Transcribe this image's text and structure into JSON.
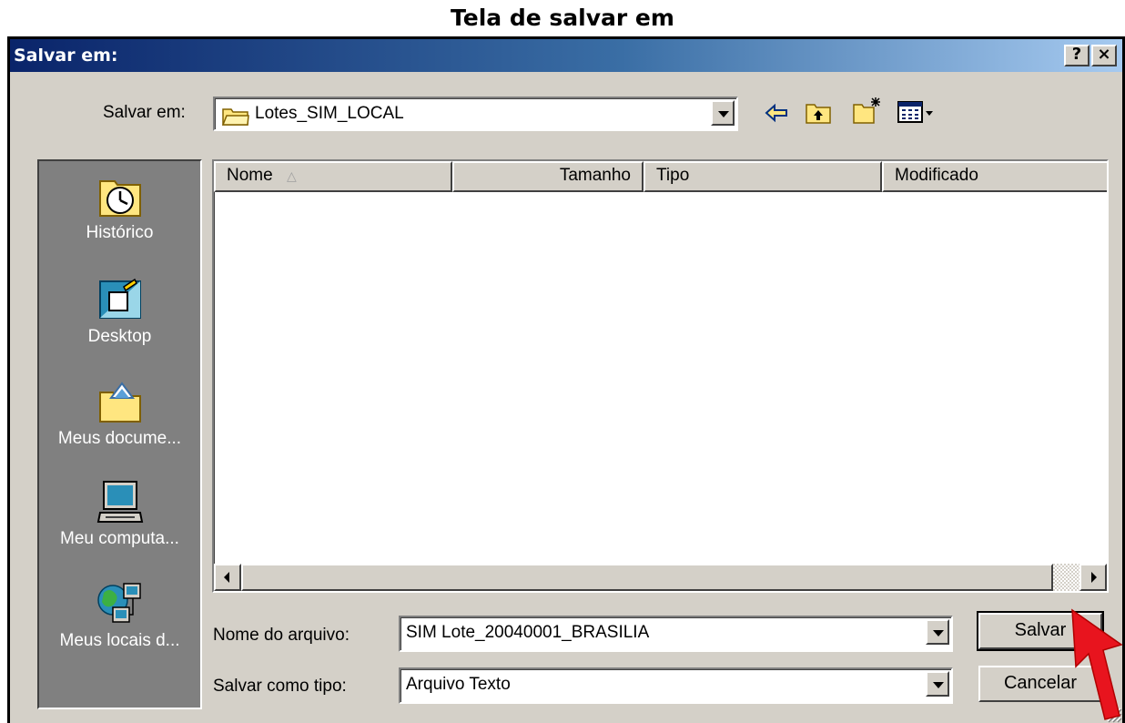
{
  "caption": "Tela de salvar em",
  "dialog": {
    "title": "Salvar em:",
    "help_label": "?",
    "close_label": "×"
  },
  "save_in": {
    "label": "Salvar em:",
    "value": "Lotes_SIM_LOCAL",
    "icons": [
      "folder-icon",
      "back-arrow-icon",
      "up-folder-icon",
      "new-folder-icon",
      "view-menu-icon"
    ]
  },
  "places": [
    {
      "label": "Histórico",
      "icon": "history-icon"
    },
    {
      "label": "Desktop",
      "icon": "desktop-icon"
    },
    {
      "label": "Meus docume...",
      "icon": "my-documents-icon"
    },
    {
      "label": "Meu computa...",
      "icon": "my-computer-icon"
    },
    {
      "label": "Meus locais d...",
      "icon": "network-places-icon"
    }
  ],
  "file_list": {
    "columns": [
      "Nome",
      "Tamanho",
      "Tipo",
      "Modificado"
    ],
    "rows": []
  },
  "file_name": {
    "label": "Nome do arquivo:",
    "value": "SIM Lote_20040001_BRASILIA"
  },
  "file_type": {
    "label": "Salvar como tipo:",
    "value": "Arquivo Texto"
  },
  "buttons": {
    "save": "Salvar",
    "cancel": "Cancelar"
  },
  "colors": {
    "annotation_arrow": "#e8141e",
    "title_gradient_start": "#0a246a",
    "title_gradient_end": "#a6caf0"
  }
}
